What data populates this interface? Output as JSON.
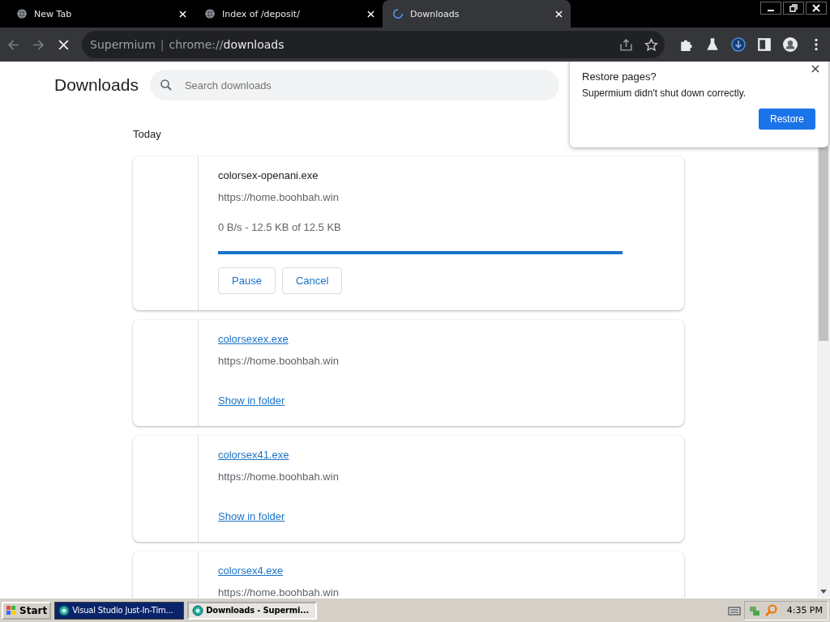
{
  "tabs": [
    {
      "title": "New Tab",
      "selected": false,
      "loading": false
    },
    {
      "title": "Index of /deposit/",
      "selected": false,
      "loading": false
    },
    {
      "title": "Downloads",
      "selected": true,
      "loading": true
    }
  ],
  "address_bar": {
    "site": "Supermium",
    "separator": "|",
    "url_prefix": "chrome://",
    "url_host": "downloads"
  },
  "page": {
    "title": "Downloads",
    "search": {
      "placeholder": "Search downloads"
    },
    "section": "Today",
    "downloads": [
      {
        "kind": "in_progress",
        "name": "colorsex-openani.exe",
        "source": "https://home.boohbah.win",
        "status": "0 B/s - 12.5 KB of 12.5 KB",
        "level": 1,
        "buttons": [
          "Pause",
          "Cancel"
        ]
      },
      {
        "kind": "complete",
        "name": "colorsexex.exe",
        "source": "https://home.boohbah.win",
        "link": "Show in folder"
      },
      {
        "kind": "complete",
        "name": "colorsex41.exe",
        "source": "https://home.boohbah.win",
        "link": "Show in folder"
      },
      {
        "kind": "complete",
        "name": "colorsex4.exe",
        "source": "https://home.boohbah.win"
      }
    ]
  },
  "restore_popup": {
    "title": "Restore pages?",
    "message": "Supermium didn't shut down correctly.",
    "button": "Restore"
  },
  "taskbar": {
    "start": "Start",
    "tasks": [
      {
        "title": "Visual Studio Just-In-Tim...",
        "selected": false
      },
      {
        "title": "Downloads - Supermi...",
        "selected": true
      }
    ],
    "clock": "4:35 PM"
  }
}
